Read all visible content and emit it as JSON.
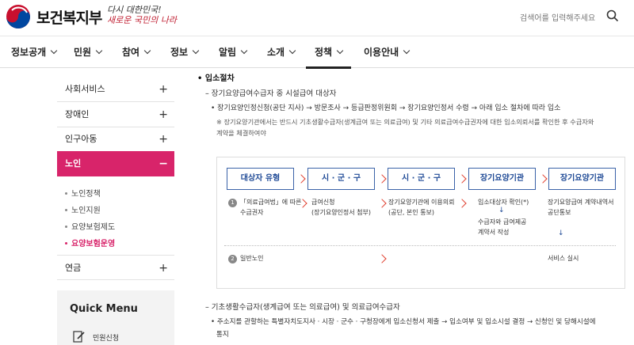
{
  "header": {
    "logo_text": "보건복지부",
    "slogan_line1": "다시 대한민국!",
    "slogan_line2": "새로운 국민의 나라",
    "search_placeholder": "검색어를 입력해주세요"
  },
  "nav": [
    {
      "label": "정보공개"
    },
    {
      "label": "민원"
    },
    {
      "label": "참여"
    },
    {
      "label": "정보"
    },
    {
      "label": "알림"
    },
    {
      "label": "소개"
    },
    {
      "label": "정책"
    },
    {
      "label": "이용안내"
    }
  ],
  "sidebar": {
    "items": [
      {
        "label": "사회서비스",
        "sign": "+"
      },
      {
        "label": "장애인",
        "sign": "+"
      },
      {
        "label": "인구아동",
        "sign": "+"
      },
      {
        "label": "노인",
        "sign": "−"
      }
    ],
    "sub_items": [
      {
        "label": "노인정책"
      },
      {
        "label": "노인지원"
      },
      {
        "label": "요양보험제도"
      },
      {
        "label": "요양보험운영"
      }
    ],
    "after": {
      "label": "연금",
      "sign": "+"
    },
    "quick_menu": {
      "title": "Quick Menu",
      "item": "민원신청"
    }
  },
  "content": {
    "section_title": "입소절차",
    "sub1": "장기요양급여수급자 중 시설급여 대상자",
    "bullet1": "장기요양인정신청(공단 지사) → 방문조사 → 등급판정위원회 → 장기요양인정서 수령 → 아래 입소 절차에 따라 입소",
    "note1": "※ 장기요양기관에서는 반드시 기초생활수급자(생계급여 또는 의료급여) 및 기타 의료급여수급권자에 대한 입소의뢰서를 확인한 후 수급자와",
    "note2": "계약을 체결하여야",
    "flow": {
      "steps": [
        "대상자 유형",
        "시 · 군 · 구",
        "시 · 군 · 구",
        "장기요양기관",
        "장기요양기관"
      ],
      "row1_num": "1",
      "row1_col1a": "「의료급여법」에 따른",
      "row1_col1b": "수급권자",
      "row1_col2a": "급여신청",
      "row1_col2b": "(장기요양인정서 첨부)",
      "row1_col3a": "장기요양기관에 이용의뢰",
      "row1_col3b": "(공단, 본인 통보)",
      "row1_col4a": "입소대상자 확인(*)",
      "row1_col4b": "수급자와 급여제공",
      "row1_col4c": "계약서 작성",
      "row1_col5a": "장기요양급여 계약내역서",
      "row1_col5b": "공단통보",
      "down_arrow": "↓",
      "row2_num": "2",
      "row2_col1": "일반노인",
      "row2_col5": "서비스 실시"
    },
    "sub2": "기초생활수급자(생계급여 또는 의료급여) 및 의료급여수급자",
    "bullet2a": "주소지를 관할하는 특별자치도지사 · 시장 · 군수 · 구청장에게 입소신청서 제출 → 입소여부 및 입소시설 결정 → 신청인 및 당해시설에",
    "bullet2b": "통지"
  }
}
